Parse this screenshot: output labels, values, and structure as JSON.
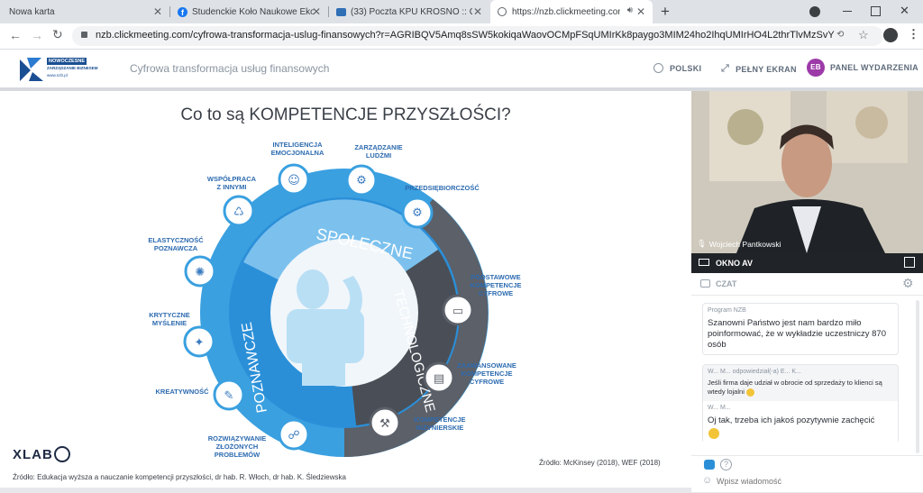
{
  "browser": {
    "tabs": [
      {
        "title": "Nowa karta",
        "active": false
      },
      {
        "title": "Studenckie Koło Naukowe Ekono",
        "active": false
      },
      {
        "title": "(33) Poczta KPU KROSNO :: Odeb",
        "active": false
      },
      {
        "title": "https://nzb.clickmeeting.com",
        "active": true
      }
    ],
    "url": "nzb.clickmeeting.com/cyfrowa-transformacja-uslug-finansowych?r=AGRIBQV5Amq8sSW5kokiqaWaovOCMpFSqUMIrKk8paygo3MIM24ho2IhqUMIrHO4L2thrTlvMzSvYzA5sU..."
  },
  "app": {
    "logo_text_1": "NOWOCZESNE",
    "logo_text_2": "ZARZĄDZANIE BIZNESEM",
    "logo_text_3": "www.nzb.pl",
    "event_title": "Cyfrowa transformacja usług finansowych",
    "language_label": "POLSKI",
    "fullscreen_label": "PEŁNY EKRAN",
    "avatar_initials": "EB",
    "panel_label": "PANEL WYDARZENIA"
  },
  "slide": {
    "title": "Co to są KOMPETENCJE PRZYSZŁOŚCI?",
    "segments": [
      "SPOŁECZNE",
      "TECHNOLOGICZNE",
      "POZNAWCZE"
    ],
    "labels": {
      "inteligencja": "INTELIGENCJA\nEMOCJONALNA",
      "zarzadzanie": "ZARZĄDZANIE\nLUDŹMI",
      "wspolpraca": "WSPÓŁPRACA\nZ INNYMI",
      "przedsiebiorczosc": "PRZEDSIĘBIORCZOŚĆ",
      "elastycznosc": "ELASTYCZNOŚĆ\nPOZNAWCZA",
      "podstawowe": "PODSTAWOWE\nKOMPETENCJE\nCYFROWE",
      "krytyczne": "KRYTYCZNE\nMYŚLENIE",
      "zaawansowane": "ZAAWANSOWANE\nKOMPETENCJE\nCYFROWE",
      "kreatywnosc": "KREATYWNOŚĆ",
      "inzynierskie": "KOMPETENCJE\nINŻYNIERSKIE",
      "rozwiazywanie": "ROZWIĄZYWANIE\nZŁOŻONYCH\nPROBLEMÓW"
    },
    "xlab": "XLAB",
    "source_right": "Źródło: McKinsey (2018), WEF (2018)",
    "source_left": "Źródło: Edukacja wyższa a nauczanie kompetencji przyszłości, dr hab. R. Włoch, dr hab. K. Śledziewska"
  },
  "video": {
    "speaker_name": "Wojciech Pantkowski",
    "panel_title": "OKNO AV"
  },
  "chat": {
    "title": "CZAT",
    "messages": [
      {
        "author": "Program NZB",
        "text": "Szanowni Państwo jest nam bardzo miło poinformować, że w wykładzie uczestniczy 870 osób"
      },
      {
        "author": "W... M... odpowiedział(-a) E... K...",
        "quote": "Jeśli firma daje udział w obrocie od sprzedaży to klienci są wtedy lojalni",
        "author2": "W... M...",
        "text": "Oj tak, trzeba ich jakoś pozytywnie zachęcić"
      }
    ],
    "input_placeholder": "Wpisz wiadomość"
  }
}
